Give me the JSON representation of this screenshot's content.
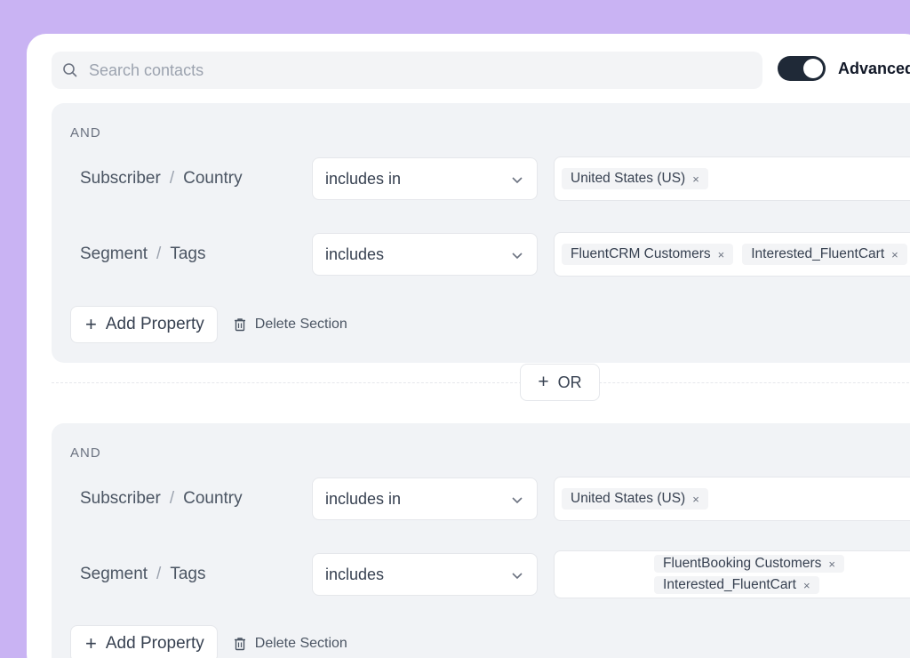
{
  "search": {
    "placeholder": "Search contacts"
  },
  "advanced": {
    "label": "Advanced",
    "enabled": true
  },
  "or_button": {
    "label": "OR"
  },
  "sections": [
    {
      "and_label": "AND",
      "rows": [
        {
          "property": "Subscriber",
          "field": "Country",
          "operator": "includes in",
          "values": [
            "United States (US)"
          ]
        },
        {
          "property": "Segment",
          "field": "Tags",
          "operator": "includes",
          "values": [
            "FluentCRM Customers",
            "Interested_FluentCart"
          ]
        }
      ],
      "add_property_label": "Add Property",
      "delete_section_label": "Delete Section"
    },
    {
      "and_label": "AND",
      "rows": [
        {
          "property": "Subscriber",
          "field": "Country",
          "operator": "includes in",
          "values": [
            "United States (US)"
          ]
        },
        {
          "property": "Segment",
          "field": "Tags",
          "operator": "includes",
          "values": [
            "FluentBooking Customers",
            "Interested_FluentCart"
          ]
        }
      ],
      "add_property_label": "Add Property",
      "delete_section_label": "Delete Section"
    }
  ],
  "separator": "/",
  "chip_remove": "×",
  "colors": {
    "background": "#c9b3f3",
    "toggle": "#1f2937",
    "section_bg": "#f1f3f6"
  }
}
